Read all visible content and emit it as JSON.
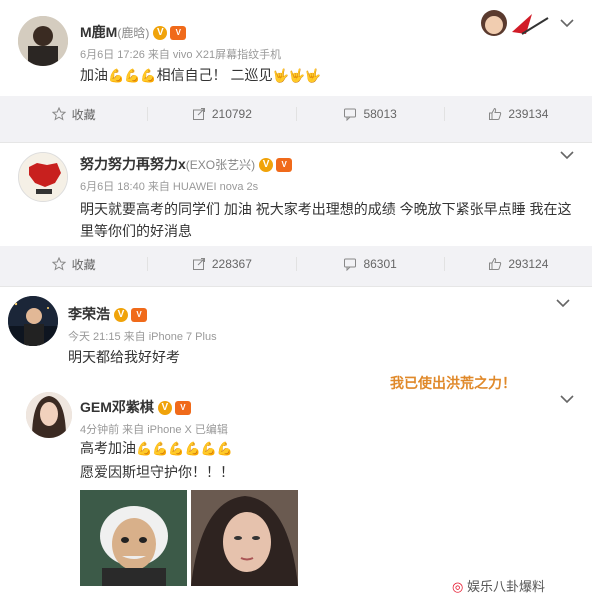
{
  "posts": [
    {
      "name": "M鹿M",
      "name_sub": "(鹿晗)",
      "meta": "6月6日 17:26 来自 vivo X21屏幕指纹手机",
      "text_a": "加油",
      "emoji_a": "💪💪💪",
      "text_b": "相信自己！ 二巡见",
      "emoji_b": "🤟🤟🤟",
      "actions": {
        "fav": "收藏",
        "share": "210792",
        "comment": "58013",
        "like": "239134"
      }
    },
    {
      "name": "努力努力再努力x",
      "name_sub": "(EXO张艺兴)",
      "meta": "6月6日 18:40 来自 HUAWEI nova 2s",
      "text": "明天就要高考的同学们 加油 祝大家考出理想的成绩 今晚放下紧张早点睡 我在这里等你们的好消息",
      "actions": {
        "fav": "收藏",
        "share": "228367",
        "comment": "86301",
        "like": "293124"
      }
    },
    {
      "name": "李荣浩",
      "meta": "今天 21:15 来自 iPhone 7 Plus",
      "text": "明天都给我好好考"
    },
    {
      "name": "GEM邓紫棋",
      "meta": "4分钟前 来自 iPhone X  已编辑",
      "line1": "高考加油",
      "emoji": "💪💪💪💪💪💪",
      "line2": "愿爱因斯坦守护你！！！"
    }
  ],
  "sticker": "我已使出洪荒之力！",
  "watermark": "娱乐八卦爆料"
}
